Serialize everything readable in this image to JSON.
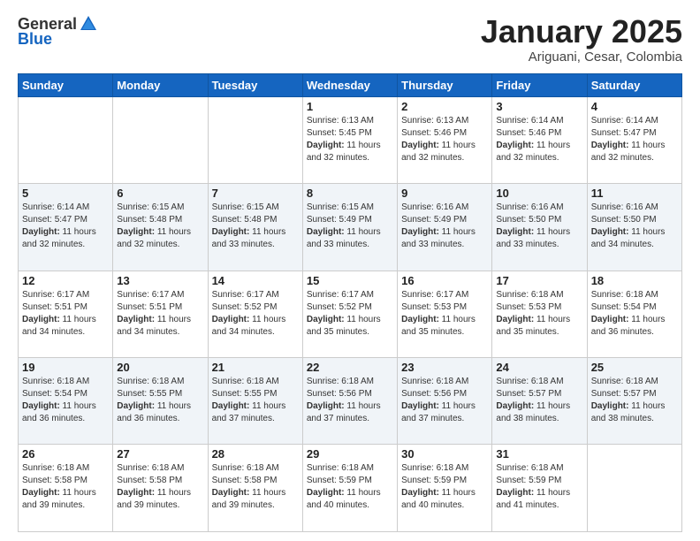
{
  "header": {
    "logo_general": "General",
    "logo_blue": "Blue",
    "month_title": "January 2025",
    "location": "Ariguani, Cesar, Colombia"
  },
  "days_of_week": [
    "Sunday",
    "Monday",
    "Tuesday",
    "Wednesday",
    "Thursday",
    "Friday",
    "Saturday"
  ],
  "weeks": [
    {
      "days": [
        {
          "num": "",
          "info": ""
        },
        {
          "num": "",
          "info": ""
        },
        {
          "num": "",
          "info": ""
        },
        {
          "num": "1",
          "info": "Sunrise: 6:13 AM\nSunset: 5:45 PM\nDaylight: 11 hours and 32 minutes."
        },
        {
          "num": "2",
          "info": "Sunrise: 6:13 AM\nSunset: 5:46 PM\nDaylight: 11 hours and 32 minutes."
        },
        {
          "num": "3",
          "info": "Sunrise: 6:14 AM\nSunset: 5:46 PM\nDaylight: 11 hours and 32 minutes."
        },
        {
          "num": "4",
          "info": "Sunrise: 6:14 AM\nSunset: 5:47 PM\nDaylight: 11 hours and 32 minutes."
        }
      ]
    },
    {
      "days": [
        {
          "num": "5",
          "info": "Sunrise: 6:14 AM\nSunset: 5:47 PM\nDaylight: 11 hours and 32 minutes."
        },
        {
          "num": "6",
          "info": "Sunrise: 6:15 AM\nSunset: 5:48 PM\nDaylight: 11 hours and 32 minutes."
        },
        {
          "num": "7",
          "info": "Sunrise: 6:15 AM\nSunset: 5:48 PM\nDaylight: 11 hours and 33 minutes."
        },
        {
          "num": "8",
          "info": "Sunrise: 6:15 AM\nSunset: 5:49 PM\nDaylight: 11 hours and 33 minutes."
        },
        {
          "num": "9",
          "info": "Sunrise: 6:16 AM\nSunset: 5:49 PM\nDaylight: 11 hours and 33 minutes."
        },
        {
          "num": "10",
          "info": "Sunrise: 6:16 AM\nSunset: 5:50 PM\nDaylight: 11 hours and 33 minutes."
        },
        {
          "num": "11",
          "info": "Sunrise: 6:16 AM\nSunset: 5:50 PM\nDaylight: 11 hours and 34 minutes."
        }
      ]
    },
    {
      "days": [
        {
          "num": "12",
          "info": "Sunrise: 6:17 AM\nSunset: 5:51 PM\nDaylight: 11 hours and 34 minutes."
        },
        {
          "num": "13",
          "info": "Sunrise: 6:17 AM\nSunset: 5:51 PM\nDaylight: 11 hours and 34 minutes."
        },
        {
          "num": "14",
          "info": "Sunrise: 6:17 AM\nSunset: 5:52 PM\nDaylight: 11 hours and 34 minutes."
        },
        {
          "num": "15",
          "info": "Sunrise: 6:17 AM\nSunset: 5:52 PM\nDaylight: 11 hours and 35 minutes."
        },
        {
          "num": "16",
          "info": "Sunrise: 6:17 AM\nSunset: 5:53 PM\nDaylight: 11 hours and 35 minutes."
        },
        {
          "num": "17",
          "info": "Sunrise: 6:18 AM\nSunset: 5:53 PM\nDaylight: 11 hours and 35 minutes."
        },
        {
          "num": "18",
          "info": "Sunrise: 6:18 AM\nSunset: 5:54 PM\nDaylight: 11 hours and 36 minutes."
        }
      ]
    },
    {
      "days": [
        {
          "num": "19",
          "info": "Sunrise: 6:18 AM\nSunset: 5:54 PM\nDaylight: 11 hours and 36 minutes."
        },
        {
          "num": "20",
          "info": "Sunrise: 6:18 AM\nSunset: 5:55 PM\nDaylight: 11 hours and 36 minutes."
        },
        {
          "num": "21",
          "info": "Sunrise: 6:18 AM\nSunset: 5:55 PM\nDaylight: 11 hours and 37 minutes."
        },
        {
          "num": "22",
          "info": "Sunrise: 6:18 AM\nSunset: 5:56 PM\nDaylight: 11 hours and 37 minutes."
        },
        {
          "num": "23",
          "info": "Sunrise: 6:18 AM\nSunset: 5:56 PM\nDaylight: 11 hours and 37 minutes."
        },
        {
          "num": "24",
          "info": "Sunrise: 6:18 AM\nSunset: 5:57 PM\nDaylight: 11 hours and 38 minutes."
        },
        {
          "num": "25",
          "info": "Sunrise: 6:18 AM\nSunset: 5:57 PM\nDaylight: 11 hours and 38 minutes."
        }
      ]
    },
    {
      "days": [
        {
          "num": "26",
          "info": "Sunrise: 6:18 AM\nSunset: 5:58 PM\nDaylight: 11 hours and 39 minutes."
        },
        {
          "num": "27",
          "info": "Sunrise: 6:18 AM\nSunset: 5:58 PM\nDaylight: 11 hours and 39 minutes."
        },
        {
          "num": "28",
          "info": "Sunrise: 6:18 AM\nSunset: 5:58 PM\nDaylight: 11 hours and 39 minutes."
        },
        {
          "num": "29",
          "info": "Sunrise: 6:18 AM\nSunset: 5:59 PM\nDaylight: 11 hours and 40 minutes."
        },
        {
          "num": "30",
          "info": "Sunrise: 6:18 AM\nSunset: 5:59 PM\nDaylight: 11 hours and 40 minutes."
        },
        {
          "num": "31",
          "info": "Sunrise: 6:18 AM\nSunset: 5:59 PM\nDaylight: 11 hours and 41 minutes."
        },
        {
          "num": "",
          "info": ""
        }
      ]
    }
  ]
}
